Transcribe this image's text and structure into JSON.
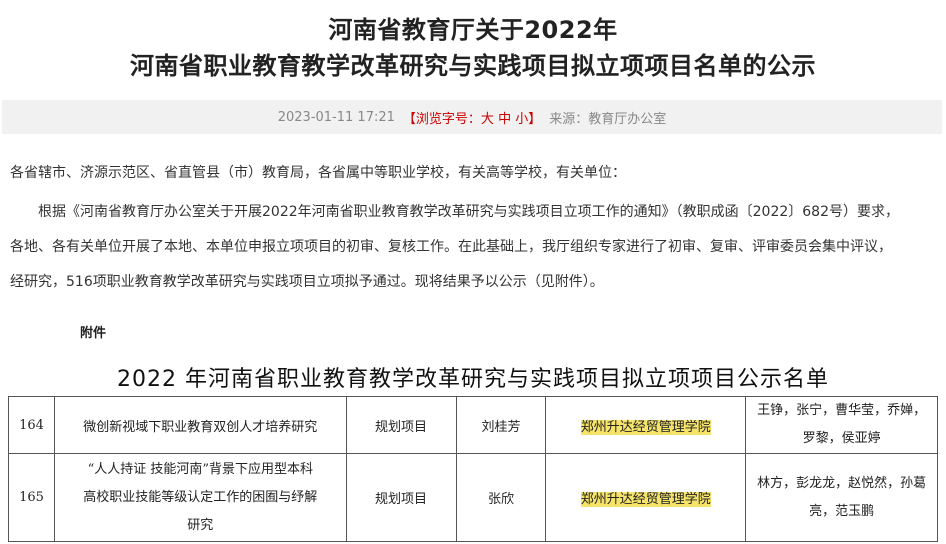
{
  "article": {
    "title_line1": "河南省教育厅关于2022年",
    "title_line2": "河南省职业教育教学改革研究与实践项目拟立项项目名单的公示",
    "meta": {
      "date": "2023-01-11 17:21",
      "font_size_prefix": "【浏览字号：",
      "size_large": "大",
      "size_medium": "中",
      "size_small": "小",
      "font_size_suffix": "】",
      "source": "来源：教育厅办公室"
    },
    "para_address": "各省辖市、济源示范区、省直管县（市）教育局，各省属中等职业学校，有关高等学校，有关单位：",
    "para_body_line1": "　　根据《河南省教育厅办公室关于开展2022年河南省职业教育教学改革研究与实践项目立项工作的通知》（教职成函〔2022〕682号）要求，",
    "para_body_line2": "各地、各有关单位开展了本地、本单位申报立项项目的初审、复核工作。在此基础上，我厅组织专家进行了初审、复审、评审委员会集中评议，",
    "para_body_line3": "经研究，516项职业教育教学改革研究与实践项目立项拟予通过。现将结果予以公示（见附件）。",
    "attachment_label": "附件"
  },
  "list": {
    "title": "2022 年河南省职业教育教学改革研究与实践项目拟立项项目公示名单",
    "rows": [
      {
        "no": "164",
        "project": "微创新视域下职业教育双创人才培养研究",
        "project_lines": [
          "微创新视域下职业教育双创人才培养研究"
        ],
        "type": "规划项目",
        "leader": "刘桂芳",
        "school": "郑州升达经贸管理学院",
        "members_lines": [
          "王铮，张宁，曹华莹，乔婵，",
          "罗黎，侯亚婷"
        ]
      },
      {
        "no": "165",
        "project": "“人人持证 技能河南”背景下应用型本科高校职业技能等级认定工作的困囿与纾解研究",
        "project_lines": [
          "“人人持证 技能河南”背景下应用型本科",
          "高校职业技能等级认定工作的困囿与纾解",
          "研究"
        ],
        "type": "规划项目",
        "leader": "张欣",
        "school": "郑州升达经贸管理学院",
        "members_lines": [
          "林方，彭龙龙，赵悦然，孙葛",
          "亮，范玉鹏"
        ]
      }
    ]
  },
  "colors": {
    "meta_bar_bg": "#f1f1f1",
    "font_size_red": "#cc0000",
    "highlight": "#f5e36a"
  }
}
